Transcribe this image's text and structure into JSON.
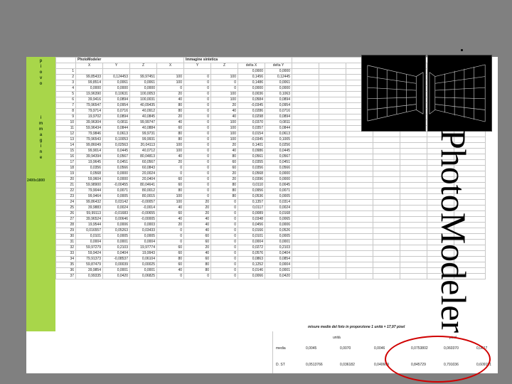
{
  "slide_title": "PhotoModeler",
  "sidebar": {
    "letters_top": [
      "p",
      "i",
      "o",
      "v",
      "o"
    ],
    "letters_mid": [
      "i",
      "m",
      "m",
      "a",
      "g",
      "i",
      "n",
      "e"
    ],
    "tag": "2400x1800"
  },
  "table": {
    "group_headers": [
      "PhotoModeler",
      "Immagine sintetica"
    ],
    "col_headers": [
      "",
      "X",
      "Y",
      "Z",
      "X",
      "Y",
      "Z",
      "delta X",
      "delta Y"
    ],
    "rows": [
      [
        "1",
        "",
        "",
        "",
        "",
        "",
        "",
        "0,0000",
        "0,0000"
      ],
      [
        "2",
        "99,85433",
        "0,124453",
        "99,97451",
        "100",
        "0",
        "100",
        "0,1456",
        "0,12445"
      ],
      [
        "3",
        "99,8514",
        "0,0061",
        "0,0061",
        "100",
        "0",
        "0",
        "0,1486",
        "0,0061"
      ],
      [
        "4",
        "0,0000",
        "0,0000",
        "0,0000",
        "0",
        "0",
        "0",
        "0,0000",
        "0,0000"
      ],
      [
        "5",
        "19,96390",
        "0,10631",
        "100,0053",
        "20",
        "0",
        "100",
        "0,0036",
        "0,1063"
      ],
      [
        "6",
        "39,9416",
        "0,0894",
        "100,0031",
        "40",
        "0",
        "100",
        "0,0584",
        "0,0894"
      ],
      [
        "7",
        "79,96547",
        "0,0954",
        "40,09435",
        "80",
        "0",
        "20",
        "-0,0345",
        "0,0954"
      ],
      [
        "8",
        "79,9714",
        "0,0716",
        "40,0912",
        "80",
        "0",
        "40",
        "0,0286",
        "0,0716"
      ],
      [
        "9",
        "19,9702",
        "0,0894",
        "40,0845",
        "20",
        "0",
        "40",
        "0,0298",
        "0,0894"
      ],
      [
        "10",
        "39,96304",
        "0,0811",
        "99,99747",
        "40",
        "0",
        "100",
        "0,0370",
        "0,0811"
      ],
      [
        "11",
        "59,96434",
        "0,0844",
        "40,0884",
        "60",
        "0",
        "100",
        "0,0357",
        "0,0844"
      ],
      [
        "12",
        "79,9846",
        "0,0613",
        "99,9731",
        "80",
        "0",
        "100",
        "0,0154",
        "0,0613"
      ],
      [
        "13",
        "79,96543",
        "0,10053",
        "99,9931",
        "80",
        "0",
        "100",
        "-0,0345",
        "0,1005"
      ],
      [
        "14",
        "99,86049",
        "0,02563",
        "20,04113",
        "100",
        "0",
        "20",
        "0,1401",
        "0,0256"
      ],
      [
        "15",
        "99,9014",
        "0,0445",
        "40,0712",
        "100",
        "0",
        "40",
        "0,0986",
        "0,0445"
      ],
      [
        "16",
        "39,94394",
        "0,0567",
        "80,04813",
        "40",
        "0",
        "80",
        "0,0561",
        "0,0567"
      ],
      [
        "17",
        "19,9645",
        "0,0451",
        "60,0567",
        "20",
        "0",
        "60",
        "0,0355",
        "0,0451"
      ],
      [
        "18",
        "0,0356",
        "0,0566",
        "60,0843",
        "0",
        "0",
        "60",
        "0,0356",
        "0,0566"
      ],
      [
        "19",
        "0,0568",
        "0,0000",
        "20,0024",
        "0",
        "0",
        "20",
        "0,0568",
        "0,0000"
      ],
      [
        "20",
        "59,9604",
        "0,0000",
        "20,0404",
        "60",
        "0",
        "20",
        "0,0396",
        "0,0000"
      ],
      [
        "21",
        "59,98900",
        "-0,00455",
        "80,04641",
        "60",
        "0",
        "80",
        "0,0110",
        "0,0045"
      ],
      [
        "22",
        "79,9044",
        "0,0071",
        "80,0012",
        "80",
        "0",
        "80",
        "0,0956",
        "0,0071"
      ],
      [
        "23",
        "99,9464",
        "0,0005",
        "80,0015",
        "100",
        "0",
        "80",
        "0,0536",
        "0,0005"
      ],
      [
        "24",
        "99,86432",
        "0,03142",
        "-0,00057",
        "100",
        "20",
        "0",
        "0,1357",
        "0,0314"
      ],
      [
        "25",
        "39,9883",
        "0,0024",
        "-0,0014",
        "40",
        "20",
        "0",
        "0,0117",
        "0,0024"
      ],
      [
        "26",
        "59,99113",
        "-0,01683",
        "-0,00655",
        "60",
        "20",
        "0",
        "0,0089",
        "0,0168"
      ],
      [
        "27",
        "39,96524",
        "0,00646",
        "-0,00005",
        "40",
        "40",
        "0",
        "0,0348",
        "0,0065"
      ],
      [
        "28",
        "19,9544",
        "0,0006",
        "0,0003",
        "20",
        "40",
        "0",
        "0,0456",
        "0,0006"
      ],
      [
        "29",
        "0,016557",
        "0,05263",
        "0,03433",
        "0",
        "40",
        "0",
        "0,0166",
        "0,0526"
      ],
      [
        "30",
        "0,0101",
        "0,0005",
        "0,0005",
        "0",
        "60",
        "0",
        "0,0101",
        "0,0005"
      ],
      [
        "31",
        "0,0004",
        "0,0001",
        "0,0004",
        "0",
        "60",
        "0",
        "0,0004",
        "0,0001"
      ],
      [
        "32",
        "59,97279",
        "0,2103",
        "19,97774",
        "60",
        "20",
        "0",
        "0,0272",
        "0,2103"
      ],
      [
        "33",
        "59,9424",
        "0,0404",
        "19,9943",
        "60",
        "40",
        "0",
        "0,0576",
        "0,0404"
      ],
      [
        "34",
        "79,91373",
        "-0,08537",
        "0,06104",
        "80",
        "60",
        "0",
        "0,0863",
        "0,0854"
      ],
      [
        "35",
        "59,87479",
        "0,00039",
        "0,00025",
        "60",
        "80",
        "0",
        "0,1252",
        "0,0004"
      ],
      [
        "36",
        "39,9854",
        "0,0001",
        "0,0001",
        "40",
        "80",
        "0",
        "0,0146",
        "0,0001"
      ],
      [
        "37",
        "0,99335",
        "0,0420",
        "0,06825",
        "0",
        "0",
        "0",
        "0,0066",
        "0,0420"
      ]
    ]
  },
  "summary": {
    "title": "misure medie del foto in proporzione 1 unità = 17,97 pixel",
    "unit_label": "unità",
    "pixel_label": "pixel",
    "media_label": "media",
    "media_values": [
      "0,0045",
      "0,0070",
      "0,0046",
      "0,0753802",
      "0,060370",
      "0,0617"
    ],
    "dst_label": "D. ST",
    "dst_values": [
      "0,0513766",
      "0,036182",
      "0,040669",
      "0,845729",
      "0,791036",
      "0,609181"
    ]
  },
  "colors": {
    "background": "#808080",
    "sidebar": "#a8d64a",
    "highlight_circle": "#d00000"
  }
}
